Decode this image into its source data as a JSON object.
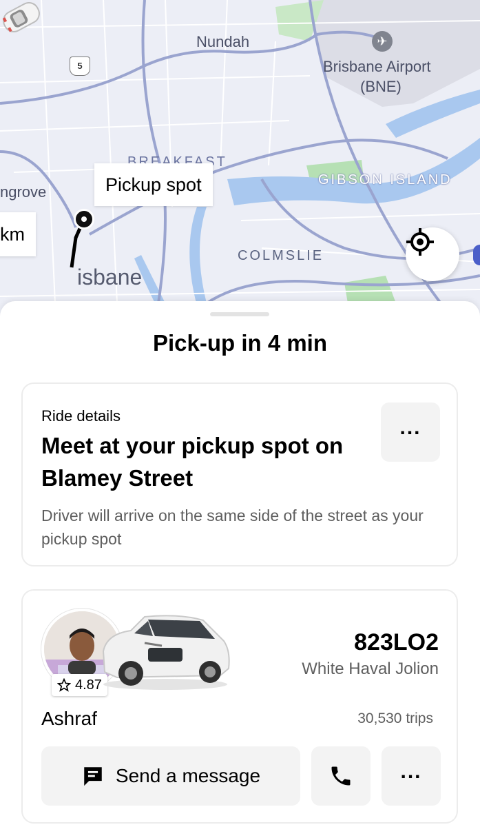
{
  "map": {
    "labels": {
      "nundah": "Nundah",
      "airport_line1": "Brisbane Airport",
      "airport_line2": "(BNE)",
      "breakfast": "BREAKFAST",
      "gibson_island": "GIBSON ISLAND",
      "grove": "ngrove",
      "colmslie": "COLMSLIE",
      "brisbane": "isbane",
      "route": "5"
    },
    "pickup_tag": "Pickup spot",
    "distance_tag": "km",
    "icons": {
      "locate": "crosshair-icon",
      "airport": "airplane-icon",
      "car": "car-marker-icon"
    }
  },
  "sheet": {
    "title": "Pick-up in 4 min",
    "ride_details": {
      "label": "Ride details",
      "title": "Meet at your pickup spot on Blamey Street",
      "description": "Driver will arrive on the same side of the street as your pickup spot",
      "more_label": "..."
    },
    "driver": {
      "rating": "4.87",
      "plate": "823LO2",
      "car": "White Haval Jolion",
      "name": "Ashraf",
      "trips": "30,530 trips",
      "message_label": "Send a message",
      "more_label": "...",
      "icons": {
        "message": "chat-icon",
        "call": "phone-icon",
        "star": "star-icon"
      }
    }
  },
  "colors": {
    "map_bg": "#eceef6",
    "road": "#9aa4cf",
    "water": "#a9c8ef",
    "park": "#b6e0b4",
    "accent": "#000000"
  }
}
